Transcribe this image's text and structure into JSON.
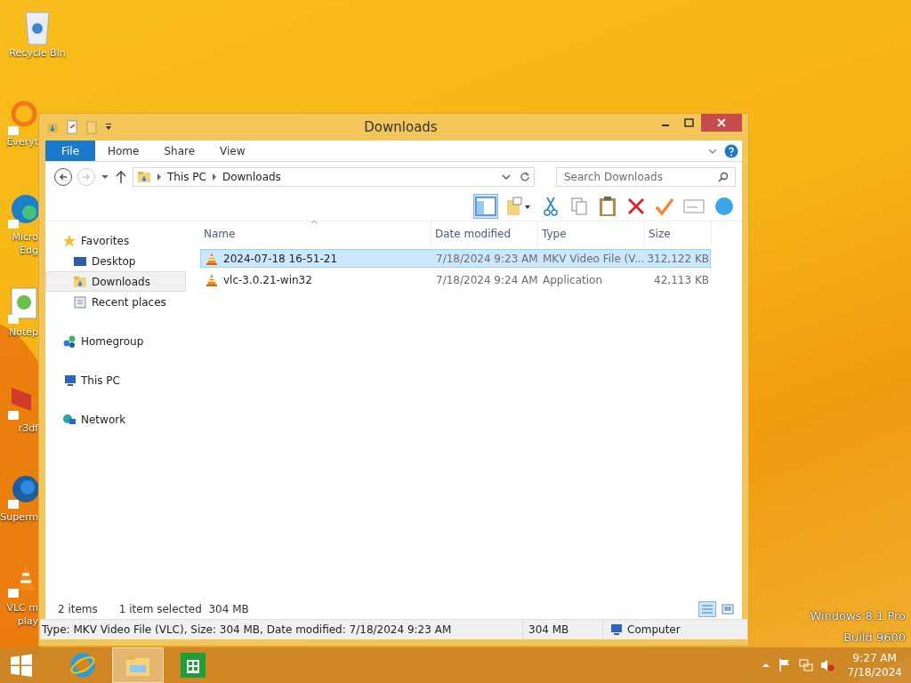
{
  "desktop": {
    "icons": [
      {
        "kind": "recycle",
        "lines": [
          "Recycle Bin"
        ]
      },
      {
        "kind": "search",
        "lines": [
          "Everyt"
        ]
      },
      {
        "kind": "edge",
        "lines": [
          "Micro",
          "Edg"
        ]
      },
      {
        "kind": "notepad",
        "lines": [
          "Notep"
        ]
      },
      {
        "kind": "red",
        "lines": [
          "r3df"
        ]
      },
      {
        "kind": "globe",
        "lines": [
          "Superm"
        ]
      },
      {
        "kind": "cone",
        "lines": [
          "VLC m",
          "play"
        ]
      }
    ],
    "watermark": [
      "Windows 8.1 Pro",
      "Build 9600"
    ]
  },
  "window": {
    "title": "Downloads",
    "ribbon_tabs": [
      {
        "label": "File",
        "kind": "file"
      },
      {
        "label": "Home",
        "kind": "tab"
      },
      {
        "label": "Share",
        "kind": "tab"
      },
      {
        "label": "View",
        "kind": "tab"
      }
    ],
    "nav_buttons": [
      {
        "kind": "back",
        "disabled": false
      },
      {
        "kind": "forward",
        "disabled": true
      }
    ],
    "address": {
      "crumbs": [
        "This PC",
        "Downloads"
      ]
    },
    "search": {
      "placeholder": "Search Downloads"
    },
    "toolbar": {
      "preview_pane": {
        "on": true
      }
    },
    "navigation_pane": [
      {
        "label": "Favorites",
        "kind": "star",
        "selected": false,
        "children": [
          {
            "label": "Desktop",
            "kind": "desktop",
            "selected": false
          },
          {
            "label": "Downloads",
            "kind": "downloads",
            "selected": true
          },
          {
            "label": "Recent places",
            "kind": "recent",
            "selected": false
          }
        ]
      },
      {
        "label": "Homegroup",
        "kind": "homegroup",
        "selected": false
      },
      {
        "label": "This PC",
        "kind": "pc",
        "selected": false
      },
      {
        "label": "Network",
        "kind": "network",
        "selected": false
      }
    ],
    "table": {
      "columns": [
        "Name",
        "Date modified",
        "Type",
        "Size"
      ],
      "rows": [
        {
          "name": "2024-07-18 16-51-21",
          "date": "7/18/2024 9:23 AM",
          "type": "MKV Video File (V...",
          "size": "312,122 KB",
          "selected": true
        },
        {
          "name": "vlc-3.0.21-win32",
          "date": "7/18/2024 9:24 AM",
          "type": "Application",
          "size": "42,113 KB",
          "selected": false
        }
      ]
    },
    "status": {
      "count": "2 items",
      "selection": "1 item selected  304 MB",
      "views": [
        {
          "kind": "details",
          "selected": true
        },
        {
          "kind": "large",
          "selected": false
        }
      ]
    },
    "details_bar": {
      "text": "Type: MKV Video File (VLC), Size: 304 MB, Date modified: 7/18/2024 9:23 AM",
      "size": "304 MB",
      "location": "Computer"
    }
  },
  "taskbar": {
    "apps": [
      {
        "kind": "ie",
        "active": false
      },
      {
        "kind": "explorer",
        "active": true
      },
      {
        "kind": "store",
        "active": false
      }
    ],
    "clock": {
      "time": "9:27 AM",
      "date": "7/18/2024"
    }
  }
}
